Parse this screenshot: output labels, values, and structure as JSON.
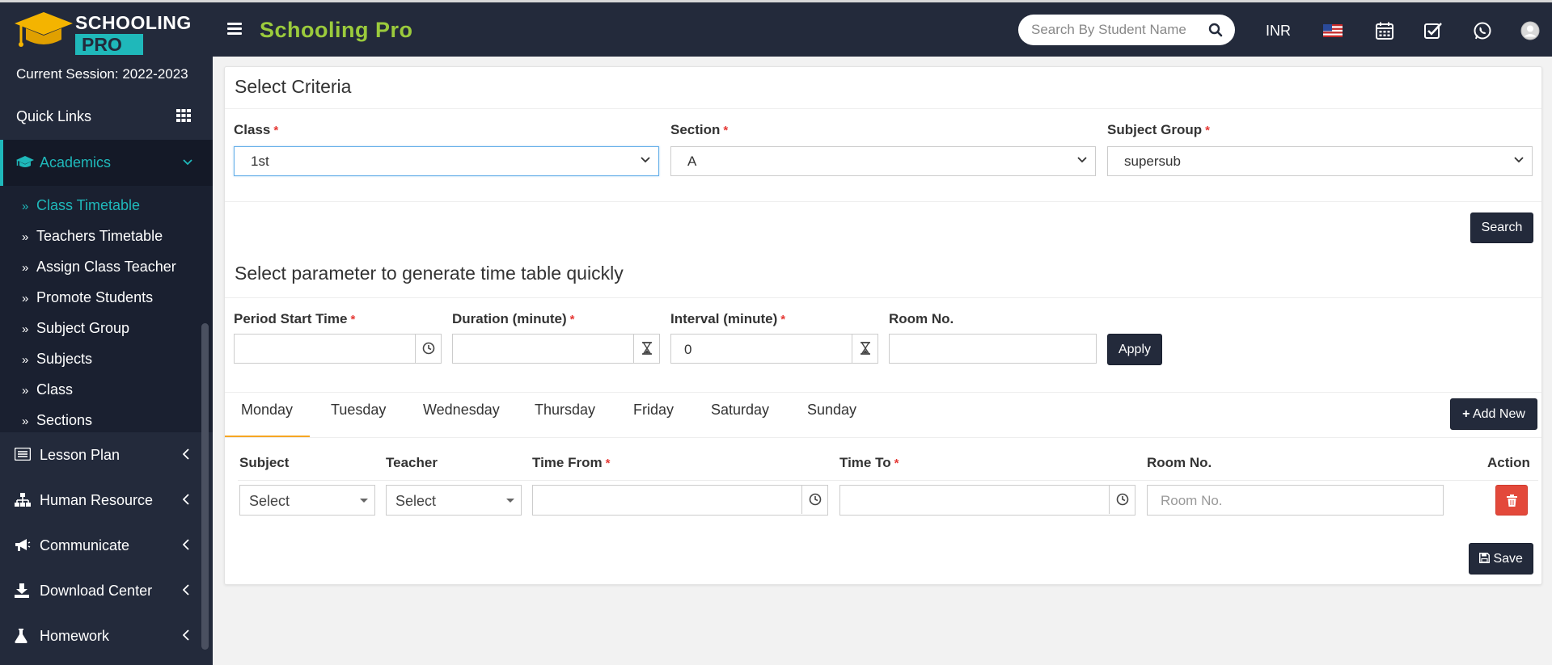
{
  "app": {
    "title": "Schooling Pro",
    "logo_line1": "SCHOOLING",
    "logo_line2": "PRO",
    "search_placeholder": "Search By Student Name",
    "currency": "INR"
  },
  "sidebar": {
    "session": "Current Session: 2022-2023",
    "quick_links": "Quick Links",
    "academics": "Academics",
    "submenu": [
      {
        "label": "Class Timetable"
      },
      {
        "label": "Teachers Timetable"
      },
      {
        "label": "Assign Class Teacher"
      },
      {
        "label": "Promote Students"
      },
      {
        "label": "Subject Group"
      },
      {
        "label": "Subjects"
      },
      {
        "label": "Class"
      },
      {
        "label": "Sections"
      }
    ],
    "menu": [
      {
        "label": "Lesson Plan"
      },
      {
        "label": "Human Resource"
      },
      {
        "label": "Communicate"
      },
      {
        "label": "Download Center"
      },
      {
        "label": "Homework"
      }
    ]
  },
  "criteria": {
    "title": "Select Criteria",
    "class_label": "Class",
    "class_value": "1st",
    "section_label": "Section",
    "section_value": "A",
    "subject_group_label": "Subject Group",
    "subject_group_value": "supersub",
    "search_button": "Search"
  },
  "generator": {
    "title": "Select parameter to generate time table quickly",
    "period_start_label": "Period Start Time",
    "duration_label": "Duration (minute)",
    "interval_label": "Interval (minute)",
    "interval_value": "0",
    "room_label": "Room No.",
    "apply_button": "Apply"
  },
  "tabs": [
    {
      "label": "Monday"
    },
    {
      "label": "Tuesday"
    },
    {
      "label": "Wednesday"
    },
    {
      "label": "Thursday"
    },
    {
      "label": "Friday"
    },
    {
      "label": "Saturday"
    },
    {
      "label": "Sunday"
    }
  ],
  "add_new_button": "Add New",
  "table": {
    "headers": {
      "subject": "Subject",
      "teacher": "Teacher",
      "time_from": "Time From",
      "time_to": "Time To",
      "room": "Room No.",
      "action": "Action"
    },
    "row": {
      "subject": "Select",
      "teacher": "Select",
      "room_placeholder": "Room No."
    }
  },
  "required_mark": "*",
  "save_button": "Save",
  "colors": {
    "nav_bg": "#232a3b",
    "accent": "#1fb8ba",
    "title_green": "#9bcb3c",
    "tab_underline": "#f6a623",
    "danger": "#e3493b"
  }
}
